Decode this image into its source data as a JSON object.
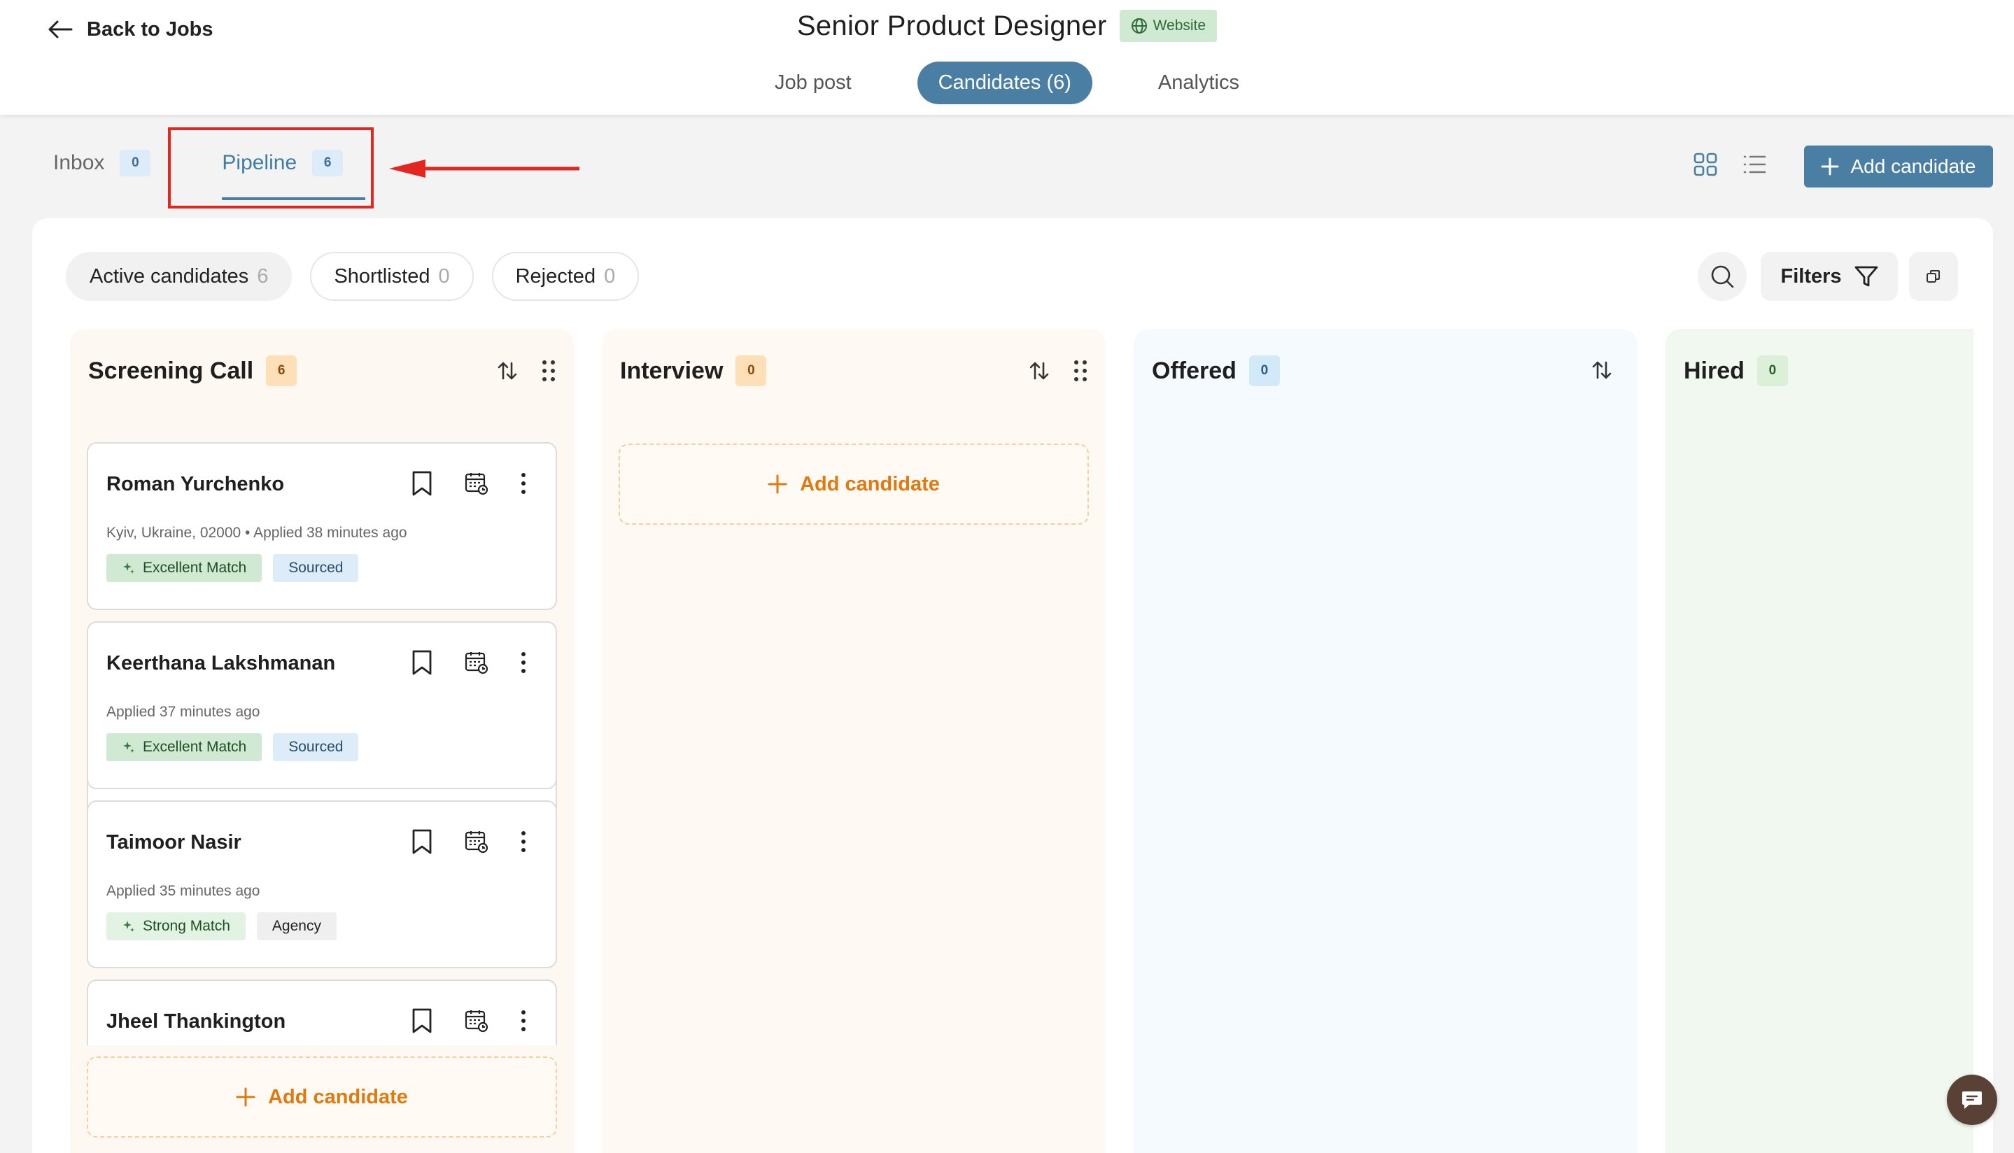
{
  "header": {
    "back_label": "Back to Jobs",
    "job_title": "Senior Product Designer",
    "badge_label": "Website",
    "tabs": [
      {
        "label": "Job post"
      },
      {
        "label": "Candidates (6)"
      },
      {
        "label": "Analytics"
      }
    ]
  },
  "subtabs": [
    {
      "label": "Inbox",
      "count": "0"
    },
    {
      "label": "Pipeline",
      "count": "6"
    }
  ],
  "toolbar": {
    "add_candidate_label": "Add candidate"
  },
  "filters": [
    {
      "label": "Active candidates",
      "count": "6"
    },
    {
      "label": "Shortlisted",
      "count": "0"
    },
    {
      "label": "Rejected",
      "count": "0"
    }
  ],
  "tools": {
    "filters_label": "Filters"
  },
  "columns": [
    {
      "title": "Screening Call",
      "count": "6",
      "add_label": "Add candidate",
      "cards": [
        {
          "name": "Roman Yurchenko",
          "meta": "Kyiv, Ukraine, 02000 • Applied 38 minutes ago",
          "match": "Excellent Match",
          "source": "Sourced"
        },
        {
          "name": "Keerthana Lakshmanan",
          "meta": "Applied 37 minutes ago",
          "match": "Excellent Match",
          "source": "Sourced"
        },
        {
          "name": "Taimoor Nasir",
          "meta": "Applied 35 minutes ago",
          "match": "Strong Match",
          "source": "Agency"
        },
        {
          "name": "Jheel Thankington"
        }
      ]
    },
    {
      "title": "Interview",
      "count": "0",
      "add_label": "Add candidate"
    },
    {
      "title": "Offered",
      "count": "0"
    },
    {
      "title": "Hired",
      "count": "0"
    }
  ],
  "colors": {
    "primary": "#4a7ea3",
    "accent_orange": "#e07a10",
    "highlight_red": "#e3261f"
  }
}
